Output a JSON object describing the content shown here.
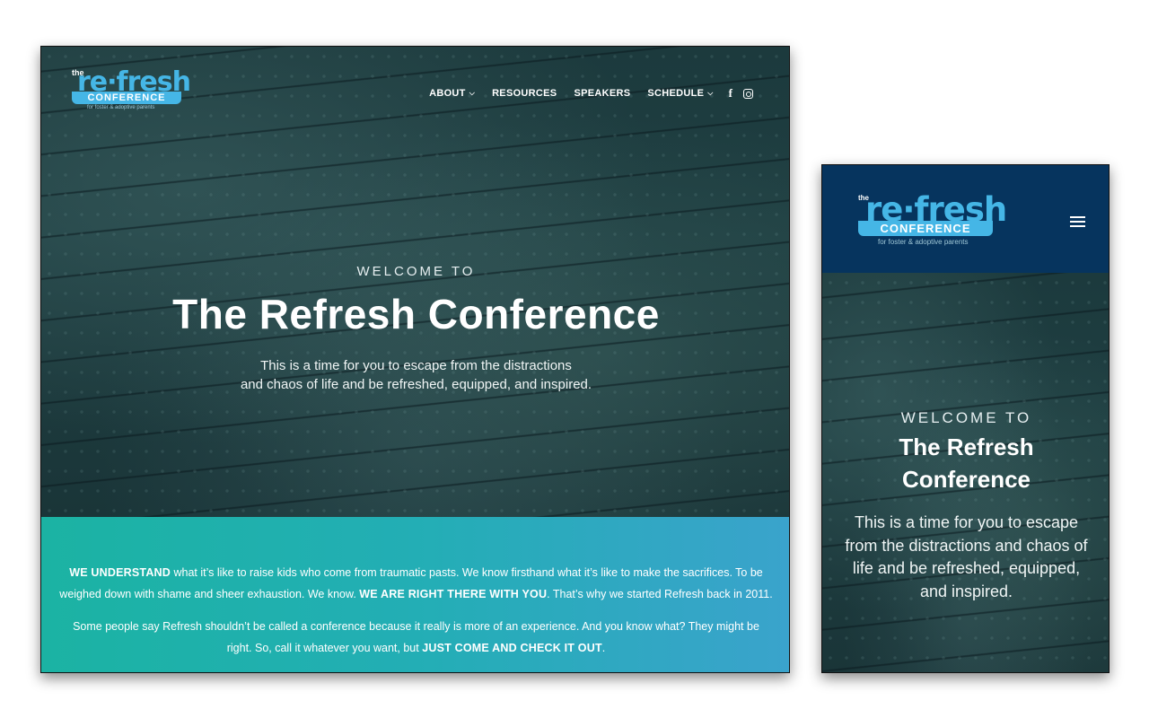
{
  "logo": {
    "the": "the",
    "refresh": "re·fresh",
    "conference": "CONFERENCE",
    "tagline": "for foster & adoptive parents"
  },
  "nav": {
    "items": [
      {
        "label": "ABOUT",
        "dropdown": true
      },
      {
        "label": "RESOURCES",
        "dropdown": false
      },
      {
        "label": "SPEAKERS",
        "dropdown": false
      },
      {
        "label": "SCHEDULE",
        "dropdown": true
      }
    ],
    "chevron": "⌄",
    "social": {
      "facebook": "f",
      "instagram": "instagram-icon"
    }
  },
  "hero": {
    "welcome": "WELCOME TO",
    "title": "The Refresh Conference",
    "title_mobile_line1": "The Refresh",
    "title_mobile_line2": "Conference",
    "lead_line1": "This is a time for you to escape from the distractions",
    "lead_line2": "and chaos of life and be refreshed, equipped, and inspired.",
    "lead_mobile": "This is a time for you to escape from the distractions and chaos of life and be refreshed, equipped, and inspired."
  },
  "band": {
    "p1_b1": "WE UNDERSTAND",
    "p1_t1": " what it’s like to raise kids who come from traumatic pasts. We know firsthand what it’s like to make the sacrifices. To be weighed down with shame and sheer exhaustion. We know. ",
    "p1_b2": "WE ARE RIGHT THERE WITH YOU",
    "p1_t2": ". That’s why we started Refresh back in 2011.",
    "p2_t1": "Some people say Refresh shouldn’t be called a conference because it really is more of an experience. And you know what? They might be right. So, call it whatever you want, but ",
    "p2_b1": "JUST COME AND CHECK IT OUT",
    "p2_t2": "."
  },
  "colors": {
    "brand_blue": "#45b6e6",
    "mobile_header": "#06345e",
    "band_start": "#1bb3a3",
    "band_end": "#3aa3cc"
  }
}
